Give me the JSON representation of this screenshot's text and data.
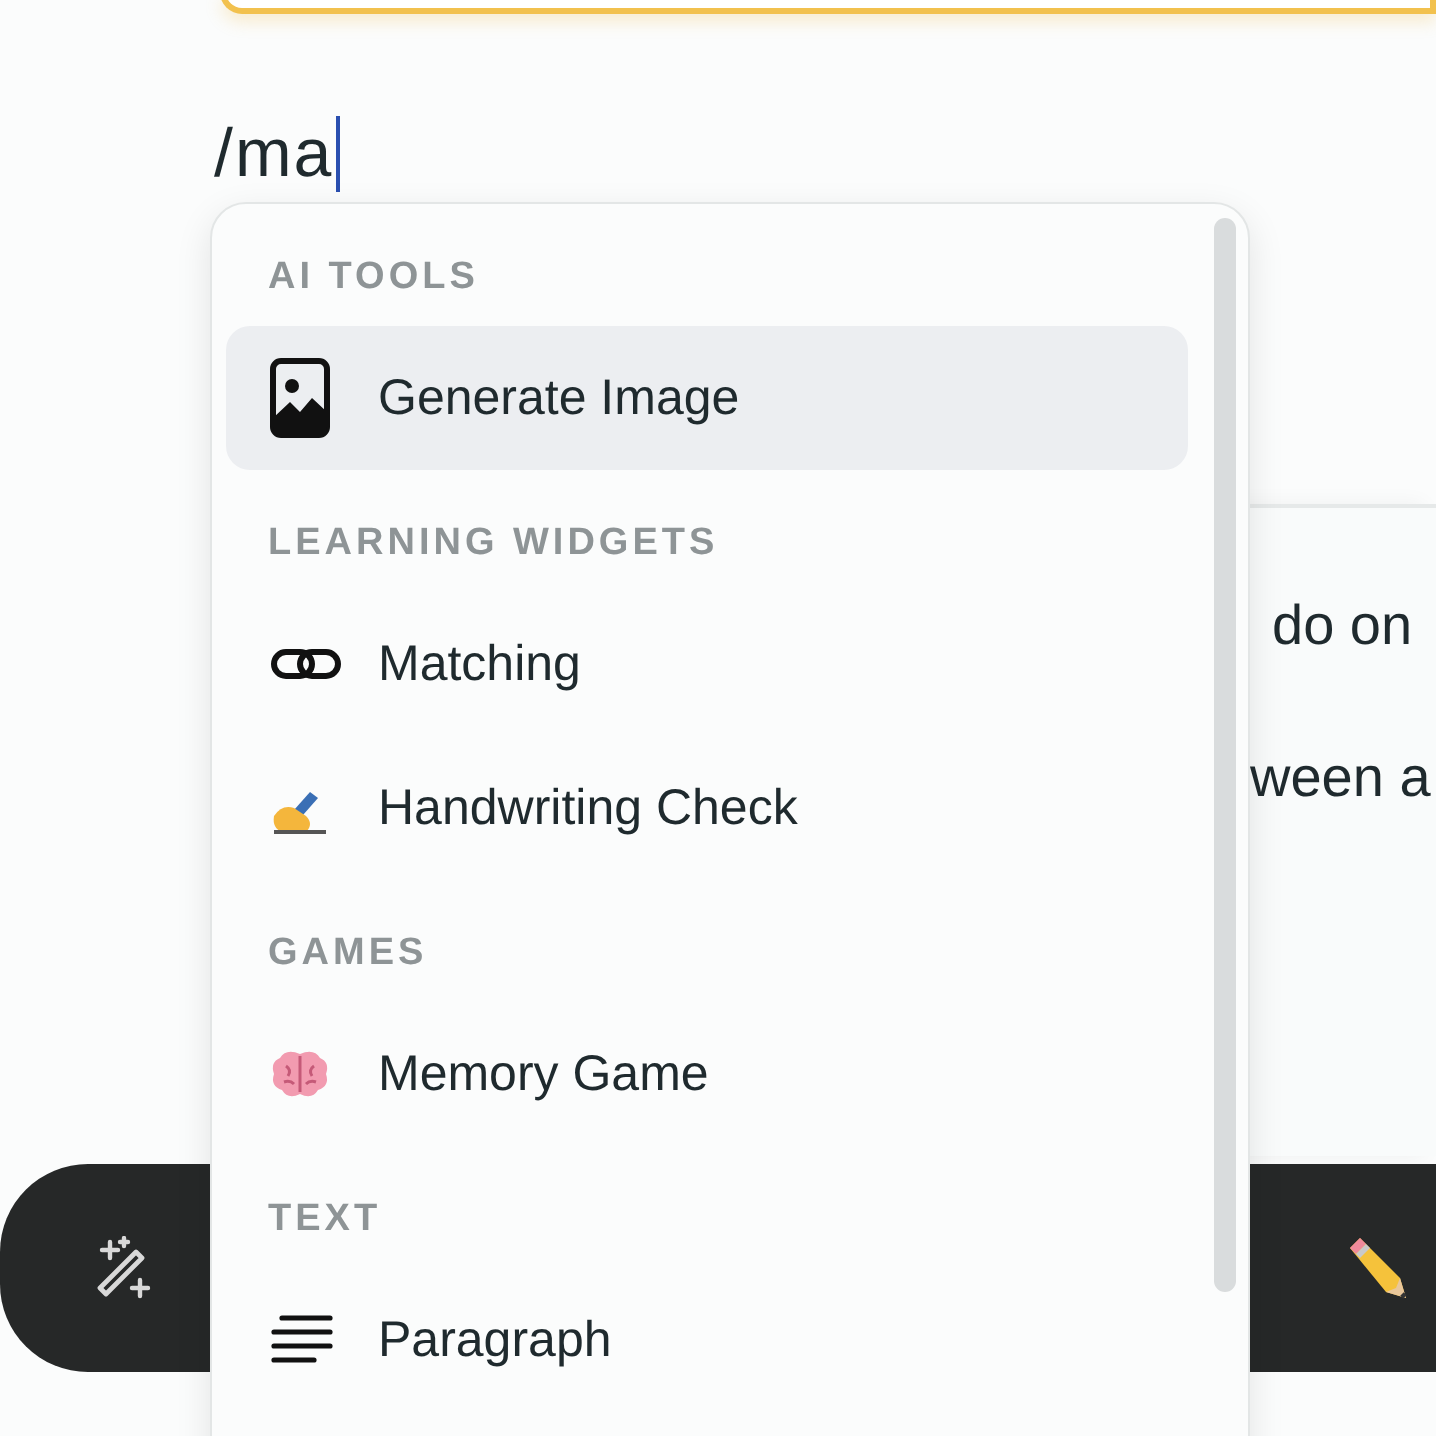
{
  "editor": {
    "text": "/ma"
  },
  "panel": {
    "lines": [
      "do on",
      "ween a"
    ]
  },
  "menu": {
    "sections": [
      {
        "title": "AI TOOLS",
        "items": [
          {
            "label": "Generate Image",
            "selected": true
          }
        ]
      },
      {
        "title": "LEARNING WIDGETS",
        "items": [
          {
            "label": "Matching",
            "selected": false
          },
          {
            "label": "Handwriting Check",
            "selected": false
          }
        ]
      },
      {
        "title": "GAMES",
        "items": [
          {
            "label": "Memory Game",
            "selected": false
          }
        ]
      },
      {
        "title": "TEXT",
        "items": [
          {
            "label": "Paragraph",
            "selected": false
          }
        ]
      }
    ]
  }
}
